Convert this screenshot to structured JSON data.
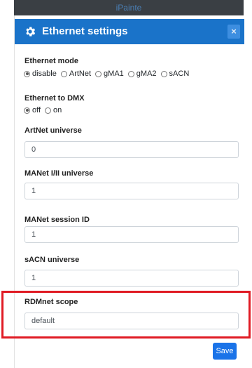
{
  "app": {
    "title": "iPainte"
  },
  "modal": {
    "title": "Ethernet settings",
    "close_label": "×"
  },
  "sections": {
    "ethernet_mode": {
      "label": "Ethernet mode",
      "options": [
        "disable",
        "ArtNet",
        "gMA1",
        "gMA2",
        "sACN"
      ],
      "selected": "disable"
    },
    "ethernet_to_dmx": {
      "label": "Ethernet to DMX",
      "options": [
        "off",
        "on"
      ],
      "selected": "off"
    },
    "artnet_universe": {
      "label": "ArtNet universe",
      "value": "0"
    },
    "manet_universe": {
      "label": "MANet I/II universe",
      "value": "1"
    },
    "manet_session": {
      "label": "MANet session ID",
      "value": "1"
    },
    "sacn_universe": {
      "label": "sACN universe",
      "value": "1"
    },
    "rdmnet_scope": {
      "label": "RDMnet scope",
      "value": "default"
    }
  },
  "footer": {
    "save_label": "Save"
  },
  "colors": {
    "header": "#1a73c9",
    "highlight": "#e01b24",
    "button": "#1a73e8"
  }
}
